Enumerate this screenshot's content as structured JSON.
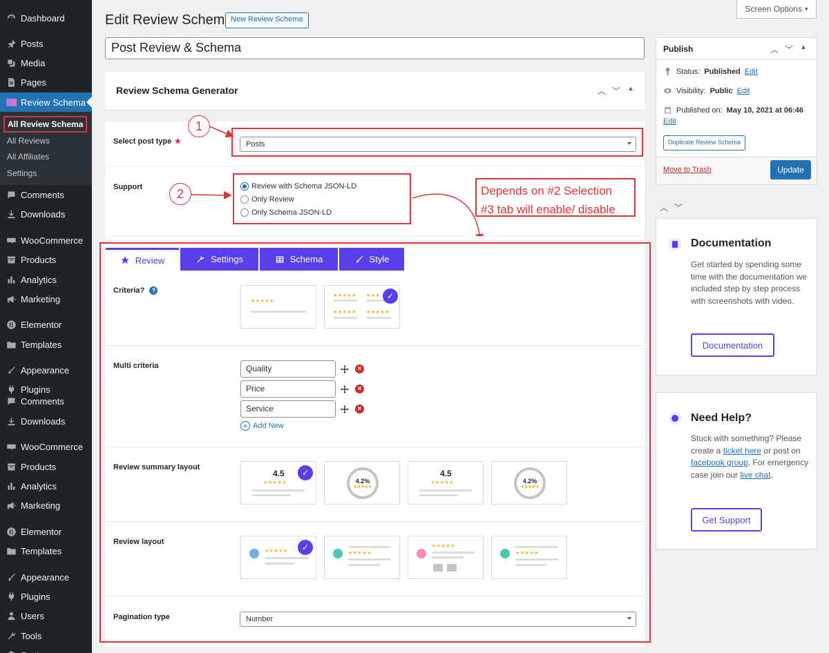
{
  "sidebar": {
    "items": [
      {
        "label": "Dashboard",
        "icon": "dashboard-icon"
      },
      {
        "label": "Posts",
        "icon": "pin-icon"
      },
      {
        "label": "Media",
        "icon": "media-icon"
      },
      {
        "label": "Pages",
        "icon": "page-icon"
      },
      {
        "label": "Review Schema",
        "icon": "review-icon"
      },
      {
        "label": "Comments",
        "icon": "comment-icon"
      },
      {
        "label": "Downloads",
        "icon": "download-icon"
      },
      {
        "label": "WooCommerce",
        "icon": "woo-icon"
      },
      {
        "label": "Products",
        "icon": "archive-icon"
      },
      {
        "label": "Analytics",
        "icon": "chart-icon"
      },
      {
        "label": "Marketing",
        "icon": "megaphone-icon"
      },
      {
        "label": "Elementor",
        "icon": "elementor-icon"
      },
      {
        "label": "Templates",
        "icon": "folder-icon"
      },
      {
        "label": "Appearance",
        "icon": "brush-icon"
      },
      {
        "label": "Plugins",
        "icon": "plugin-icon"
      },
      {
        "label": "Comments",
        "icon": "comment-icon"
      },
      {
        "label": "Downloads",
        "icon": "download-icon"
      },
      {
        "label": "WooCommerce",
        "icon": "woo-icon"
      },
      {
        "label": "Products",
        "icon": "archive-icon"
      },
      {
        "label": "Analytics",
        "icon": "chart-icon"
      },
      {
        "label": "Marketing",
        "icon": "megaphone-icon"
      },
      {
        "label": "Elementor",
        "icon": "elementor-icon"
      },
      {
        "label": "Templates",
        "icon": "folder-icon"
      },
      {
        "label": "Appearance",
        "icon": "brush-icon"
      },
      {
        "label": "Plugins",
        "icon": "plugin-icon"
      },
      {
        "label": "Users",
        "icon": "users-icon"
      },
      {
        "label": "Tools",
        "icon": "wrench-icon"
      },
      {
        "label": "Settings",
        "icon": "settings-icon"
      }
    ],
    "submenu": [
      "All Review Schema",
      "All Reviews",
      "All Affiliates",
      "Settings"
    ]
  },
  "header": {
    "title": "Edit Review Schema",
    "new_button": "New Review Schema",
    "screen_options": "Screen Options"
  },
  "post_title": "Post Review & Schema",
  "generator": {
    "title": "Review Schema Generator",
    "post_type_label": "Select post type",
    "post_type_value": "Posts",
    "support_label": "Support",
    "support_options": [
      "Review with Schema JSON-LD",
      "Only Review",
      "Only Schema JSON-LD"
    ],
    "support_selected": 0
  },
  "annotations": {
    "one": "1",
    "two": "2",
    "three": "3",
    "note_line1": "Depends on #2 Selection",
    "note_line2": "#3 tab will enable/ disable"
  },
  "tabs": [
    {
      "label": "Review",
      "icon": "star-icon"
    },
    {
      "label": "Settings",
      "icon": "wrench-icon"
    },
    {
      "label": "Schema",
      "icon": "table-icon"
    },
    {
      "label": "Style",
      "icon": "brush-icon"
    }
  ],
  "review_tab": {
    "criteria_label": "Criteria?",
    "multi_label": "Multi criteria",
    "criteria": [
      "Quality",
      "Price",
      "Service"
    ],
    "add_new": "Add New",
    "summary_label": "Review summary layout",
    "summary_values": [
      "4.5",
      "4.2%",
      "4.5",
      "4.2%"
    ],
    "layout_label": "Review layout",
    "pagination_label": "Pagination type",
    "pagination_value": "Number"
  },
  "publish": {
    "title": "Publish",
    "status_label": "Status:",
    "status_value": "Published",
    "visibility_label": "Visibility:",
    "visibility_value": "Public",
    "published_label": "Published on:",
    "published_value": "May 10, 2021 at 06:46",
    "edit": "Edit",
    "duplicate": "Duplicate Review Schema",
    "trash": "Move to Trash",
    "update": "Update"
  },
  "documentation": {
    "title": "Documentation",
    "text": "Get started by spending some time with the documentation we included step by step process with screenshots with video.",
    "button": "Documentation"
  },
  "help": {
    "title": "Need Help?",
    "text_1": "Stuck with something? Please create a",
    "link_1": "ticket here",
    "text_2": "or post on",
    "link_2": "facebook group",
    "text_3": ". For emergency case join our",
    "link_3": "live chat",
    "text_4": ".",
    "button": "Get Support"
  },
  "colors": {
    "accent": "#5b3de9",
    "wp_blue": "#2271b1",
    "annotation_red": "#d63638",
    "star": "#f0b429"
  }
}
